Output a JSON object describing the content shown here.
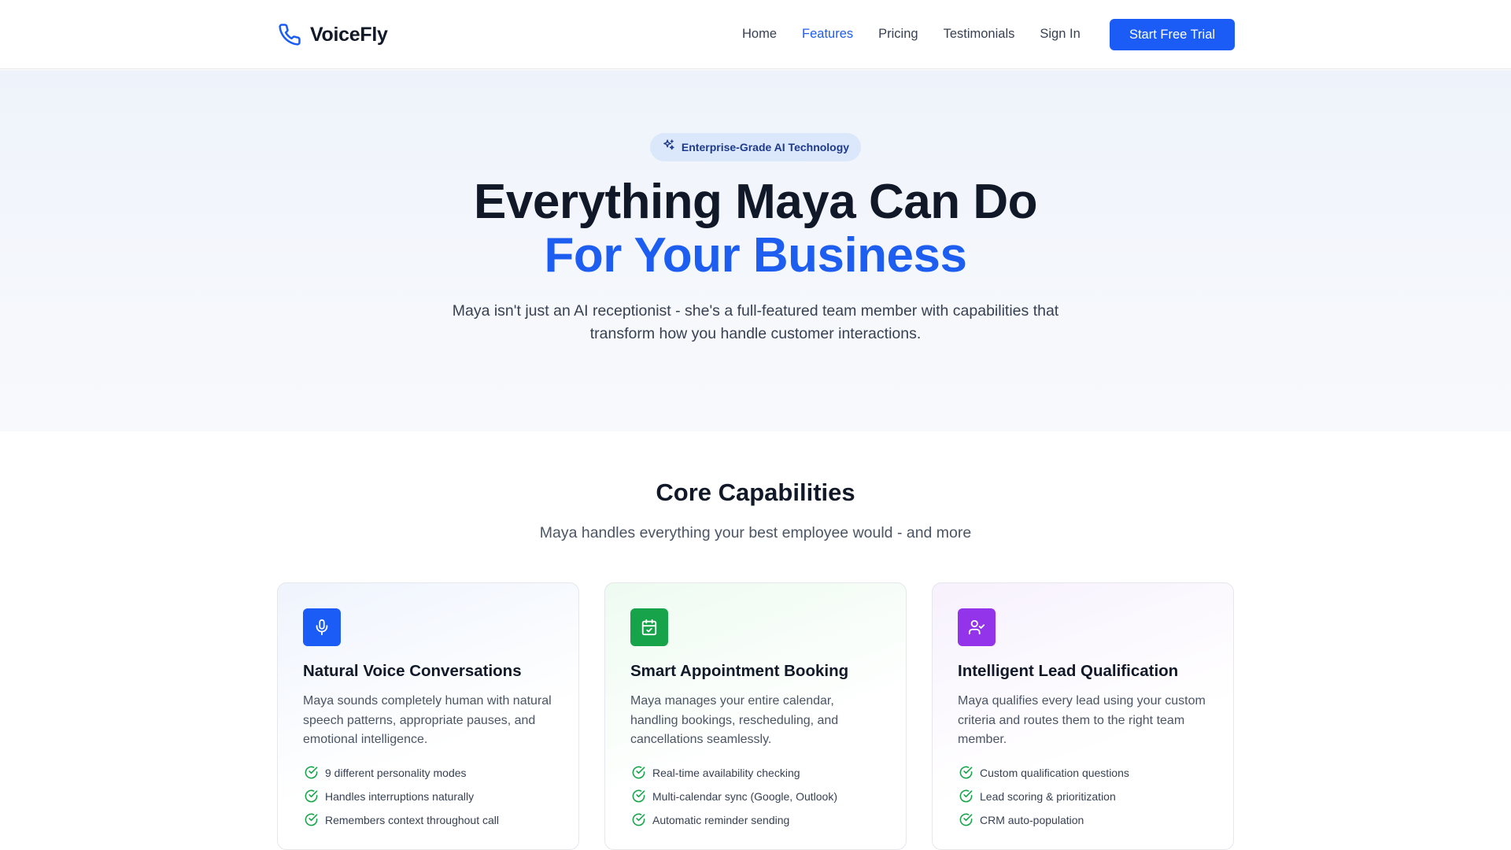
{
  "brand": {
    "name": "VoiceFly",
    "icon": "phone-icon",
    "accent": "#1a5cf5"
  },
  "nav": {
    "items": [
      {
        "label": "Home",
        "active": false
      },
      {
        "label": "Features",
        "active": true
      },
      {
        "label": "Pricing",
        "active": false
      },
      {
        "label": "Testimonials",
        "active": false
      },
      {
        "label": "Sign In",
        "active": false
      }
    ],
    "cta_label": "Start Free Trial"
  },
  "hero": {
    "badge": "Enterprise-Grade AI Technology",
    "badge_icon": "sparkles-icon",
    "title_line1": "Everything Maya Can Do",
    "title_line2": "For Your Business",
    "subtitle": "Maya isn't just an AI receptionist - she's a full-featured team member with capabilities that transform how you handle customer interactions."
  },
  "core": {
    "title": "Core Capabilities",
    "subtitle": "Maya handles everything your best employee would - and more",
    "cards": [
      {
        "icon": "microphone-icon",
        "icon_color": "#1a5cf5",
        "title": "Natural Voice Conversations",
        "description": "Maya sounds completely human with natural speech patterns, appropriate pauses, and emotional intelligence.",
        "features": [
          "9 different personality modes",
          "Handles interruptions naturally",
          "Remembers context throughout call"
        ]
      },
      {
        "icon": "calendar-check-icon",
        "icon_color": "#16a34a",
        "title": "Smart Appointment Booking",
        "description": "Maya manages your entire calendar, handling bookings, rescheduling, and cancellations seamlessly.",
        "features": [
          "Real-time availability checking",
          "Multi-calendar sync (Google, Outlook)",
          "Automatic reminder sending"
        ]
      },
      {
        "icon": "user-check-icon",
        "icon_color": "#9333ea",
        "title": "Intelligent Lead Qualification",
        "description": "Maya qualifies every lead using your custom criteria and routes them to the right team member.",
        "features": [
          "Custom qualification questions",
          "Lead scoring & prioritization",
          "CRM auto-population"
        ]
      }
    ]
  }
}
